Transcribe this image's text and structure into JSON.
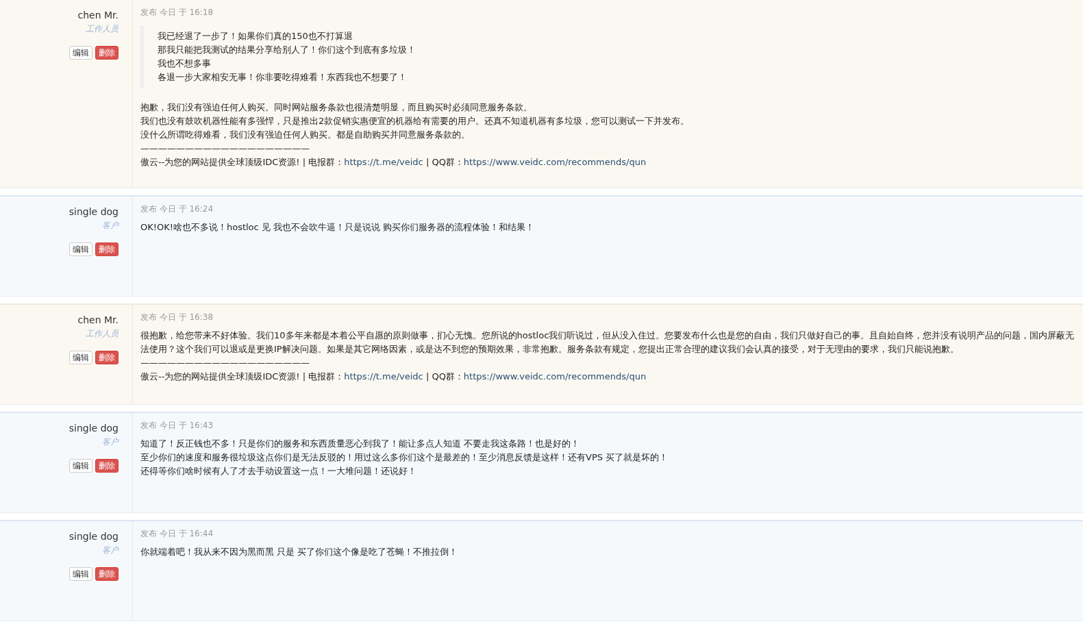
{
  "replies": [
    {
      "kind": "staff",
      "author": "chen Mr.",
      "role": "工作人员",
      "buttons": {
        "edit": "编辑",
        "delete": "删除"
      },
      "posted": "发布 今日 于 16:18",
      "quote": [
        "我已经退了一步了！如果你们真的150也不打算退",
        "那我只能把我测试的结果分享给别人了！你们这个到底有多垃圾！",
        "我也不想多事",
        "各退一步大家相安无事！你非要吃得难看！东西我也不想要了！"
      ],
      "lines": [
        "抱歉，我们没有强迫任何人购买。同时网站服务条款也很清楚明显，而且购买时必须同意服务条款。",
        "我们也没有鼓吹机器性能有多强悍，只是推出2款促销实惠便宜的机器给有需要的用户。还真不知道机器有多垃圾，您可以测试一下并发布。",
        "没什么所谓吃得难看，我们没有强迫任何人购买。都是自助购买并同意服务条款的。"
      ],
      "divider": "———————————————————",
      "signature": {
        "text_1": "傲云--为您的网站提供全球顶级IDC资源! | 电报群：",
        "link_1": "https://t.me/veidc",
        "text_2": " | QQ群：",
        "link_2": "https://www.veidc.com/recommends/qun"
      }
    },
    {
      "kind": "client",
      "author": "single dog",
      "role": "客户",
      "buttons": {
        "edit": "编辑",
        "delete": "删除"
      },
      "posted": "发布 今日 于 16:24",
      "lines": [
        "OK!OK!啥也不多说！hostloc 见 我也不会吹牛逼！只是说说 购买你们服务器的流程体验！和结果！"
      ]
    },
    {
      "kind": "staff",
      "author": "chen Mr.",
      "role": "工作人员",
      "buttons": {
        "edit": "编辑",
        "delete": "删除"
      },
      "posted": "发布 今日 于 16:38",
      "lines": [
        "很抱歉，给您带来不好体验。我们10多年来都是本着公平自愿的原则做事，扪心无愧。您所说的hostloc我们听说过，但从没入住过。您要发布什么也是您的自由，我们只做好自己的事。且自始自终，您并没有说明产品的问题，国内屏蔽无法使用？这个我们可以退或是更换IP解决问题。如果是其它网络因素，或是达不到您的预期效果，非常抱歉。服务条款有规定，您提出正常合理的建议我们会认真的接受，对于无理由的要求，我们只能说抱歉。"
      ],
      "divider": "———————————————————",
      "signature": {
        "text_1": "傲云--为您的网站提供全球顶级IDC资源! | 电报群：",
        "link_1": "https://t.me/veidc",
        "text_2": " | QQ群：",
        "link_2": "https://www.veidc.com/recommends/qun"
      }
    },
    {
      "kind": "client",
      "author": "single dog",
      "role": "客户",
      "buttons": {
        "edit": "编辑",
        "delete": "删除"
      },
      "posted": "发布 今日 于 16:43",
      "lines": [
        "知道了！反正钱也不多！只是你们的服务和东西质量恶心到我了！能让多点人知道 不要走我这条路！也是好的！",
        "至少你们的速度和服务很垃圾这点你们是无法反驳的！用过这么多你们这个是最差的！至少消息反馈是这样！还有VPS 买了就是坏的！",
        "还得等你们啥时候有人了才去手动设置这一点！一大堆问题！还说好！"
      ]
    },
    {
      "kind": "client",
      "author": "single dog",
      "role": "客户",
      "buttons": {
        "edit": "编辑",
        "delete": "删除"
      },
      "posted": "发布 今日 于 16:44",
      "lines": [
        "你就端着吧！我从来不因为黑而黑 只是 买了你们这个像是吃了苍蝇！不推拉倒！"
      ]
    }
  ]
}
